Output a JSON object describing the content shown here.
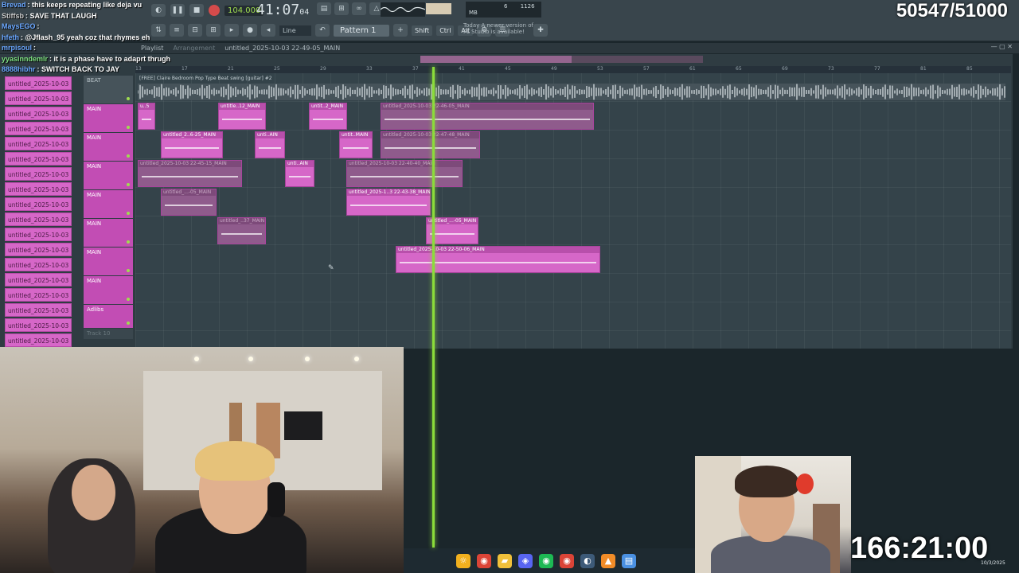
{
  "chat": [
    {
      "user": "Brevad",
      "msg": "this keeps repeating like deja vu",
      "color": "#6aa7ff"
    },
    {
      "user": "Stiffsb",
      "msg": "SAVE THAT LAUGH",
      "color": "#c9c9c9"
    },
    {
      "user": "MaysEGO",
      "msg": "",
      "color": "#6aa7ff"
    },
    {
      "user": "hfeth",
      "msg": "@Jflash_95 yeah coz that rhymes eh",
      "color": "#6aa7ff"
    },
    {
      "user": "mrpisoul",
      "msg": "",
      "color": "#6aa7ff"
    },
    {
      "user": "yyasinndemlr",
      "msg": "it is a phase have to adaprt thrugh",
      "color": "#7ee081"
    },
    {
      "user": "8888hibhr",
      "msg": "SWITCH BACK TO JAY",
      "color": "#6aa7ff"
    }
  ],
  "score": "50547/51000",
  "transport": {
    "bpm": "104.000",
    "clock": "41:07",
    "clock_sub": "04",
    "pattern": "Pattern 1",
    "snap": "Line",
    "cpu_num": "6",
    "mem": "1126 MB",
    "shift": "Shift",
    "ctrl": "Ctrl",
    "alt": "Alt",
    "news_label": "Today",
    "news": "A newer version of FL Studio is available!"
  },
  "playlist": {
    "title": "Playlist",
    "mode": "Arrangement",
    "arrangement": "untitled_2025-10-03 22-49-05_MAIN",
    "beat_clip": "[FREE] Claire Bedroom Pop Type Beat swing [guitar] #2",
    "ruler": [
      "13",
      "17",
      "21",
      "25",
      "29",
      "33",
      "37",
      "41",
      "45",
      "49",
      "53",
      "57",
      "61",
      "65",
      "69",
      "73",
      "77",
      "81",
      "85"
    ]
  },
  "clip_list": [
    "untitled_2025-10-03 22-",
    "untitled_2025-10-03 22-",
    "untitled_2025-10-03 22-",
    "untitled_2025-10-03 22-",
    "untitled_2025-10-03 22-",
    "untitled_2025-10-03 22-",
    "untitled_2025-10-03 22-",
    "untitled_2025-10-03 22-",
    "untitled_2025-10-03 22-",
    "untitled_2025-10-03 22-",
    "untitled_2025-10-03 22-",
    "untitled_2025-10-03 22-",
    "untitled_2025-10-03 22-",
    "untitled_2025-10-03 22-",
    "untitled_2025-10-03 22-",
    "untitled_2025-10-03 22-",
    "untitled_2025-10-03 22-",
    "untitled_2025-10-03 22-"
  ],
  "tracks": [
    {
      "name": "BEAT",
      "kind": "beat"
    },
    {
      "name": "MAIN",
      "kind": "vocal"
    },
    {
      "name": "MAIN",
      "kind": "vocal"
    },
    {
      "name": "MAIN",
      "kind": "vocal"
    },
    {
      "name": "MAIN",
      "kind": "vocal"
    },
    {
      "name": "MAIN",
      "kind": "vocal"
    },
    {
      "name": "MAIN",
      "kind": "vocal"
    },
    {
      "name": "MAIN",
      "kind": "vocal"
    },
    {
      "name": "Adlibs",
      "kind": "adlibs"
    },
    {
      "name": "Track 10",
      "kind": "empty"
    }
  ],
  "clips": [
    {
      "label": "u..5",
      "muted": false
    },
    {
      "label": "untitle..12_MAIN",
      "muted": false
    },
    {
      "label": "untit..2_MAIN",
      "muted": false
    },
    {
      "label": "untitled_2025-10-03 22-46-05_MAIN",
      "muted": true
    },
    {
      "label": "untitled_2..6-25_MAIN",
      "muted": false
    },
    {
      "label": "unti..AIN",
      "muted": false
    },
    {
      "label": "untit..MAIN",
      "muted": false
    },
    {
      "label": "untitled_2025-10-03 22-47-48_MAIN",
      "muted": true
    },
    {
      "label": "untitled_2025-10-03 22-45-15_MAIN",
      "muted": true
    },
    {
      "label": "unti..AIN",
      "muted": false
    },
    {
      "label": "untitled_2025-10-03 22-40-40_MAIN",
      "muted": true
    },
    {
      "label": "untitled_...-05_MAIN",
      "muted": true
    },
    {
      "label": "untitled_2025-1..3 22-43-38_MAIN",
      "muted": false
    },
    {
      "label": "untitled_..37_MAIN",
      "muted": true
    },
    {
      "label": "untitled_...-05_MAIN",
      "muted": false
    },
    {
      "label": "untitled_2025-10-03 22-50-06_MAIN",
      "muted": false
    }
  ],
  "stream_timer": "166:21:00",
  "date": "10/3/2025",
  "colors": {
    "accent": "#d667c8",
    "playhead": "#8bdc3a",
    "bg": "#2f3c42"
  },
  "taskbar_icons": [
    "weather-icon",
    "chrome-icon",
    "folder-icon",
    "discord-icon",
    "spotify-icon",
    "chrome2-icon",
    "steam-icon",
    "fl-studio-icon",
    "notepad-icon"
  ]
}
